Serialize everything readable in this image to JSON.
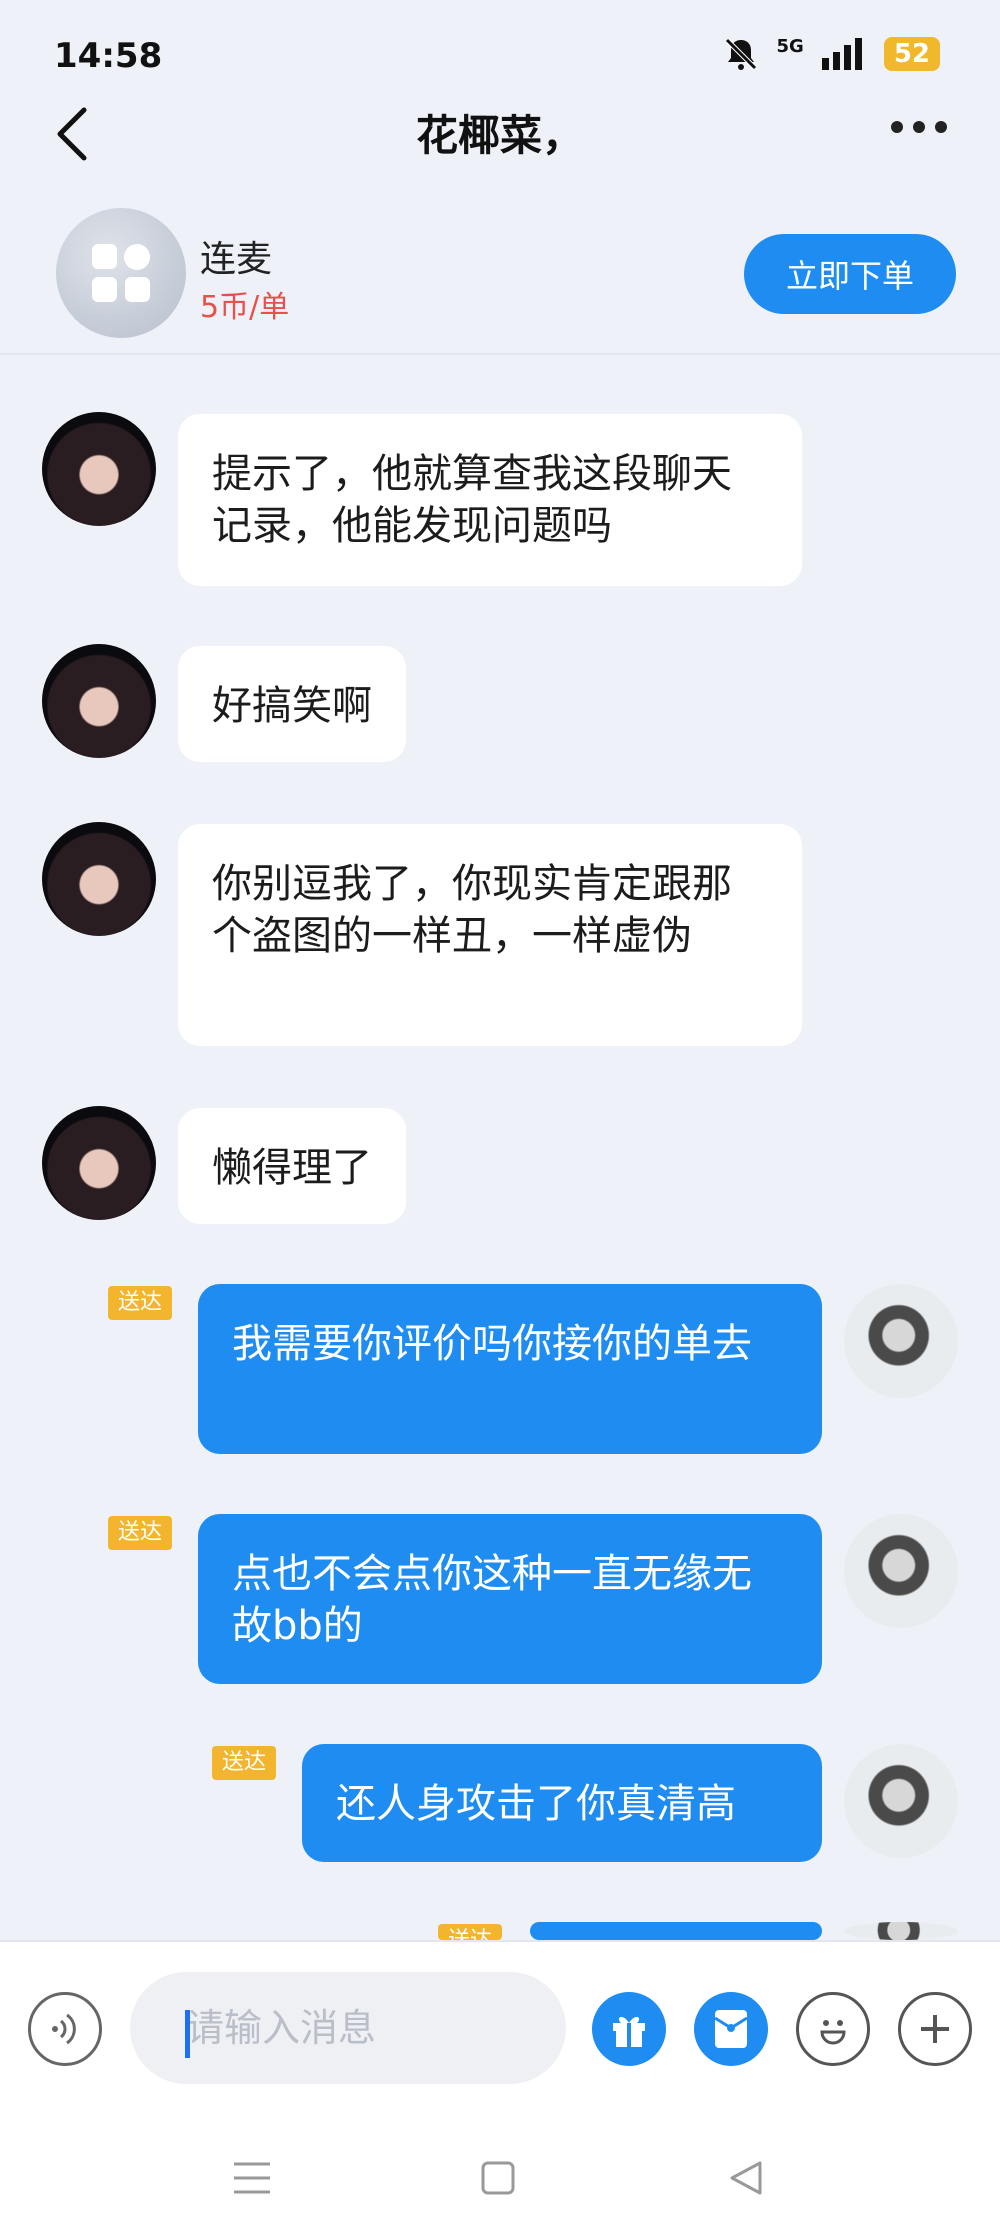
{
  "status_bar": {
    "time": "14:58",
    "network": "5G",
    "battery": "52"
  },
  "header": {
    "title": "花椰菜，"
  },
  "service": {
    "name": "连麦",
    "price": "5币/单",
    "order_label": "立即下单"
  },
  "messages": [
    {
      "side": "in",
      "text": "提示了，他就算查我这段聊天记录，他能发现问题吗"
    },
    {
      "side": "in",
      "text": "好搞笑啊"
    },
    {
      "side": "in",
      "text": "你别逗我了，你现实肯定跟那个盗图的一样丑，一样虚伪"
    },
    {
      "side": "in",
      "text": "懒得理了"
    },
    {
      "side": "out",
      "status": "送达",
      "text": "我需要你评价吗你接你的单去"
    },
    {
      "side": "out",
      "status": "送达",
      "text": "点也不会点你这种一直无缘无故bb的"
    },
    {
      "side": "out",
      "status": "送达",
      "text": "还人身攻击了你真清高"
    },
    {
      "side": "out",
      "status": "送达",
      "text": ""
    }
  ],
  "input": {
    "placeholder": "请输入消息"
  },
  "colors": {
    "accent": "#1f8cf2",
    "badge": "#f4b52e",
    "price": "#e8504b",
    "battery": "#f0b82a"
  },
  "icons": [
    "back-icon",
    "more-icon",
    "apps-icon",
    "voice-icon",
    "gift-icon",
    "red-envelope-icon",
    "emoji-icon",
    "plus-icon",
    "menu-nav-icon",
    "home-nav-icon",
    "back-nav-icon"
  ]
}
